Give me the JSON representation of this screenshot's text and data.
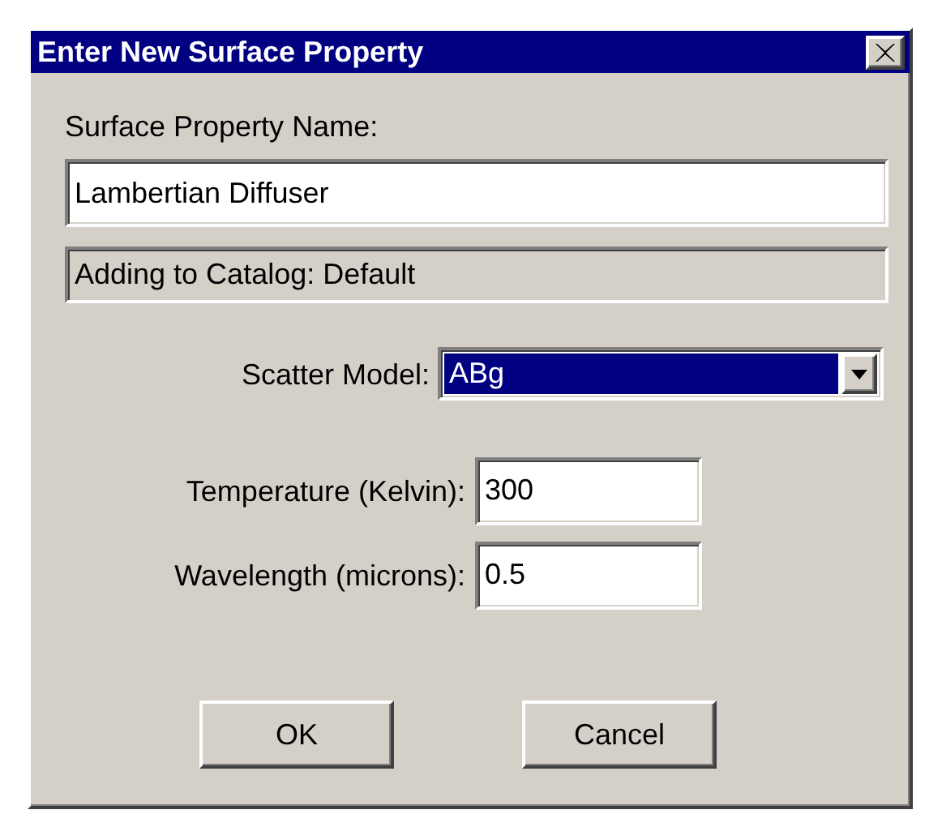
{
  "window": {
    "title": "Enter New Surface Property"
  },
  "name_field": {
    "label": "Surface Property Name:",
    "value": "Lambertian Diffuser"
  },
  "catalog_info": "Adding to Catalog: Default",
  "scatter_model": {
    "label": "Scatter Model:",
    "value": "ABg",
    "focused": true
  },
  "parameters": [
    {
      "label": "Temperature (Kelvin):",
      "value": "300"
    },
    {
      "label": "Wavelength (microns):",
      "value": "0.5"
    }
  ],
  "buttons": [
    "OK",
    "Cancel"
  ]
}
